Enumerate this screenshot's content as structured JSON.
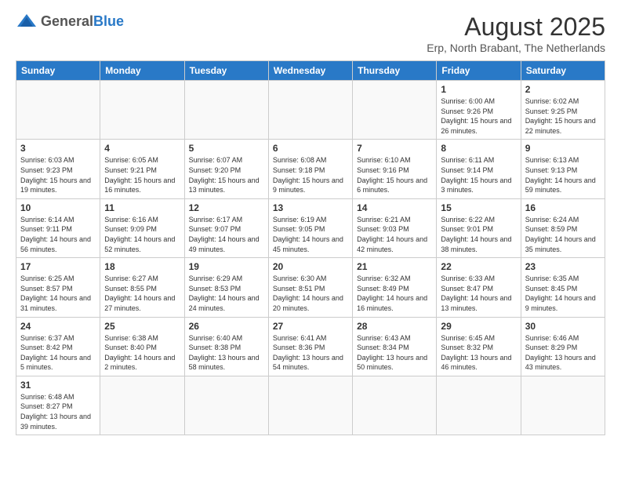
{
  "header": {
    "logo_general": "General",
    "logo_blue": "Blue",
    "month_year": "August 2025",
    "location": "Erp, North Brabant, The Netherlands"
  },
  "weekdays": [
    "Sunday",
    "Monday",
    "Tuesday",
    "Wednesday",
    "Thursday",
    "Friday",
    "Saturday"
  ],
  "weeks": [
    [
      {
        "day": "",
        "info": ""
      },
      {
        "day": "",
        "info": ""
      },
      {
        "day": "",
        "info": ""
      },
      {
        "day": "",
        "info": ""
      },
      {
        "day": "",
        "info": ""
      },
      {
        "day": "1",
        "info": "Sunrise: 6:00 AM\nSunset: 9:26 PM\nDaylight: 15 hours and 26 minutes."
      },
      {
        "day": "2",
        "info": "Sunrise: 6:02 AM\nSunset: 9:25 PM\nDaylight: 15 hours and 22 minutes."
      }
    ],
    [
      {
        "day": "3",
        "info": "Sunrise: 6:03 AM\nSunset: 9:23 PM\nDaylight: 15 hours and 19 minutes."
      },
      {
        "day": "4",
        "info": "Sunrise: 6:05 AM\nSunset: 9:21 PM\nDaylight: 15 hours and 16 minutes."
      },
      {
        "day": "5",
        "info": "Sunrise: 6:07 AM\nSunset: 9:20 PM\nDaylight: 15 hours and 13 minutes."
      },
      {
        "day": "6",
        "info": "Sunrise: 6:08 AM\nSunset: 9:18 PM\nDaylight: 15 hours and 9 minutes."
      },
      {
        "day": "7",
        "info": "Sunrise: 6:10 AM\nSunset: 9:16 PM\nDaylight: 15 hours and 6 minutes."
      },
      {
        "day": "8",
        "info": "Sunrise: 6:11 AM\nSunset: 9:14 PM\nDaylight: 15 hours and 3 minutes."
      },
      {
        "day": "9",
        "info": "Sunrise: 6:13 AM\nSunset: 9:13 PM\nDaylight: 14 hours and 59 minutes."
      }
    ],
    [
      {
        "day": "10",
        "info": "Sunrise: 6:14 AM\nSunset: 9:11 PM\nDaylight: 14 hours and 56 minutes."
      },
      {
        "day": "11",
        "info": "Sunrise: 6:16 AM\nSunset: 9:09 PM\nDaylight: 14 hours and 52 minutes."
      },
      {
        "day": "12",
        "info": "Sunrise: 6:17 AM\nSunset: 9:07 PM\nDaylight: 14 hours and 49 minutes."
      },
      {
        "day": "13",
        "info": "Sunrise: 6:19 AM\nSunset: 9:05 PM\nDaylight: 14 hours and 45 minutes."
      },
      {
        "day": "14",
        "info": "Sunrise: 6:21 AM\nSunset: 9:03 PM\nDaylight: 14 hours and 42 minutes."
      },
      {
        "day": "15",
        "info": "Sunrise: 6:22 AM\nSunset: 9:01 PM\nDaylight: 14 hours and 38 minutes."
      },
      {
        "day": "16",
        "info": "Sunrise: 6:24 AM\nSunset: 8:59 PM\nDaylight: 14 hours and 35 minutes."
      }
    ],
    [
      {
        "day": "17",
        "info": "Sunrise: 6:25 AM\nSunset: 8:57 PM\nDaylight: 14 hours and 31 minutes."
      },
      {
        "day": "18",
        "info": "Sunrise: 6:27 AM\nSunset: 8:55 PM\nDaylight: 14 hours and 27 minutes."
      },
      {
        "day": "19",
        "info": "Sunrise: 6:29 AM\nSunset: 8:53 PM\nDaylight: 14 hours and 24 minutes."
      },
      {
        "day": "20",
        "info": "Sunrise: 6:30 AM\nSunset: 8:51 PM\nDaylight: 14 hours and 20 minutes."
      },
      {
        "day": "21",
        "info": "Sunrise: 6:32 AM\nSunset: 8:49 PM\nDaylight: 14 hours and 16 minutes."
      },
      {
        "day": "22",
        "info": "Sunrise: 6:33 AM\nSunset: 8:47 PM\nDaylight: 14 hours and 13 minutes."
      },
      {
        "day": "23",
        "info": "Sunrise: 6:35 AM\nSunset: 8:45 PM\nDaylight: 14 hours and 9 minutes."
      }
    ],
    [
      {
        "day": "24",
        "info": "Sunrise: 6:37 AM\nSunset: 8:42 PM\nDaylight: 14 hours and 5 minutes."
      },
      {
        "day": "25",
        "info": "Sunrise: 6:38 AM\nSunset: 8:40 PM\nDaylight: 14 hours and 2 minutes."
      },
      {
        "day": "26",
        "info": "Sunrise: 6:40 AM\nSunset: 8:38 PM\nDaylight: 13 hours and 58 minutes."
      },
      {
        "day": "27",
        "info": "Sunrise: 6:41 AM\nSunset: 8:36 PM\nDaylight: 13 hours and 54 minutes."
      },
      {
        "day": "28",
        "info": "Sunrise: 6:43 AM\nSunset: 8:34 PM\nDaylight: 13 hours and 50 minutes."
      },
      {
        "day": "29",
        "info": "Sunrise: 6:45 AM\nSunset: 8:32 PM\nDaylight: 13 hours and 46 minutes."
      },
      {
        "day": "30",
        "info": "Sunrise: 6:46 AM\nSunset: 8:29 PM\nDaylight: 13 hours and 43 minutes."
      }
    ],
    [
      {
        "day": "31",
        "info": "Sunrise: 6:48 AM\nSunset: 8:27 PM\nDaylight: 13 hours and 39 minutes."
      },
      {
        "day": "",
        "info": ""
      },
      {
        "day": "",
        "info": ""
      },
      {
        "day": "",
        "info": ""
      },
      {
        "day": "",
        "info": ""
      },
      {
        "day": "",
        "info": ""
      },
      {
        "day": "",
        "info": ""
      }
    ]
  ]
}
